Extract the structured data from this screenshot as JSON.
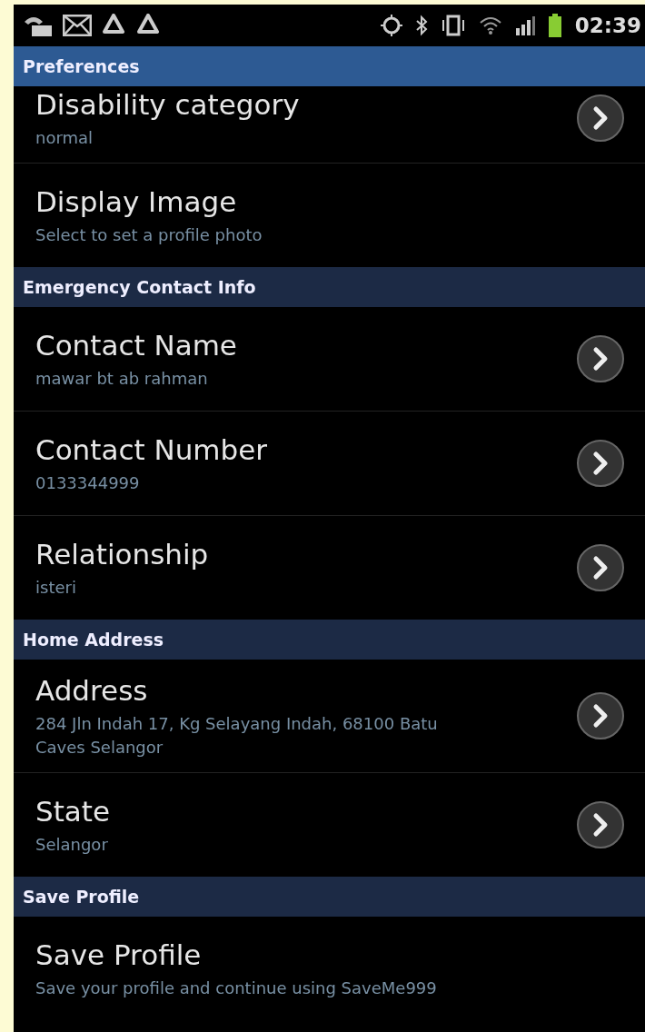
{
  "status_bar": {
    "time": "02:39"
  },
  "sections": [
    {
      "header": "Preferences",
      "items": [
        {
          "title": "Disability category",
          "summary": "normal",
          "has_arrow": true
        },
        {
          "title": "Display Image",
          "summary": "Select to set a profile photo",
          "has_arrow": false
        }
      ]
    },
    {
      "header": "Emergency Contact Info",
      "items": [
        {
          "title": "Contact Name",
          "summary": "mawar bt ab rahman",
          "has_arrow": true
        },
        {
          "title": "Contact Number",
          "summary": "0133344999",
          "has_arrow": true
        },
        {
          "title": "Relationship",
          "summary": "isteri",
          "has_arrow": true
        }
      ]
    },
    {
      "header": "Home Address",
      "items": [
        {
          "title": "Address",
          "summary": "284 Jln Indah 17, Kg Selayang Indah, 68100 Batu Caves Selangor",
          "has_arrow": true
        },
        {
          "title": "State",
          "summary": "Selangor",
          "has_arrow": true
        }
      ]
    },
    {
      "header": "Save Profile",
      "items": [
        {
          "title": "Save Profile",
          "summary": "Save your profile and continue using SaveMe999",
          "has_arrow": false
        }
      ]
    }
  ]
}
